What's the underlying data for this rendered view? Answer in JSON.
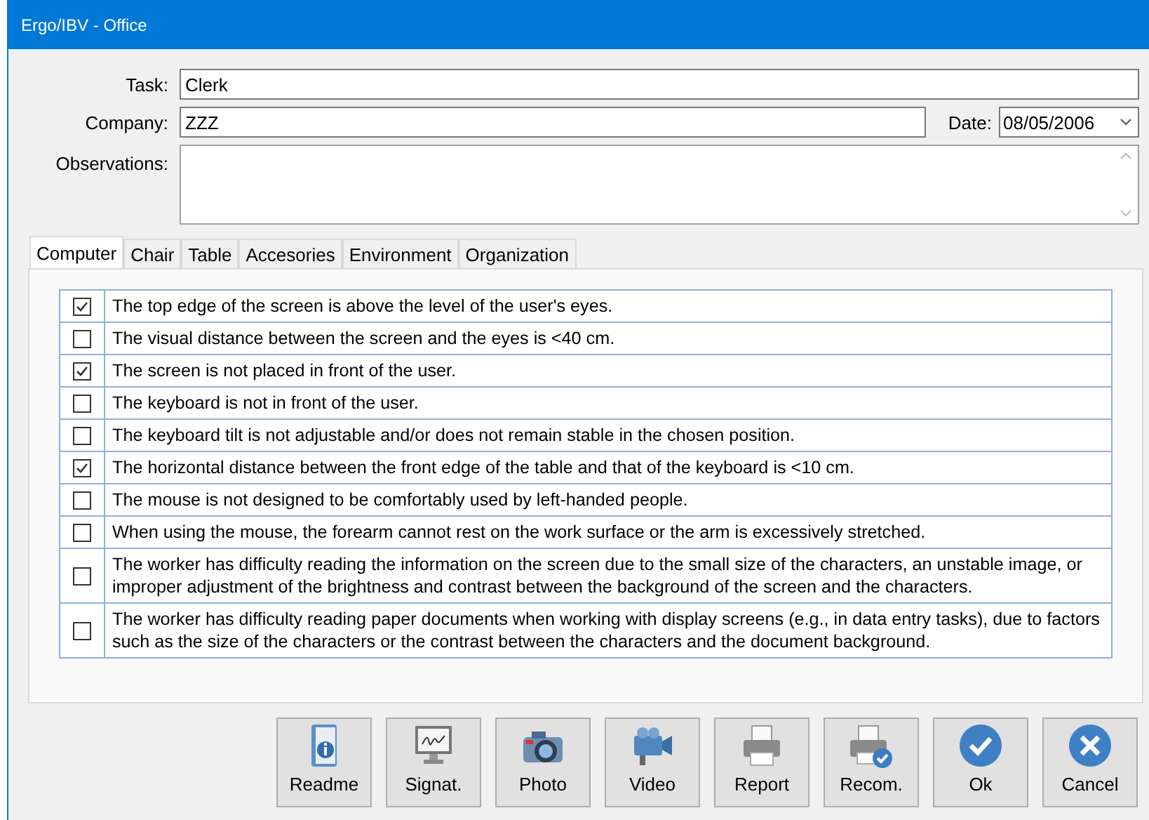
{
  "window": {
    "title": "Ergo/IBV - Office"
  },
  "form": {
    "task": {
      "label": "Task:",
      "value": "Clerk"
    },
    "company": {
      "label": "Company:",
      "value": "ZZZ"
    },
    "date": {
      "label": "Date:",
      "value": "08/05/2006"
    },
    "observations": {
      "label": "Observations:"
    }
  },
  "tabs": [
    {
      "label": "Computer",
      "selected": true
    },
    {
      "label": "Chair",
      "selected": false
    },
    {
      "label": "Table",
      "selected": false
    },
    {
      "label": "Accesories",
      "selected": false
    },
    {
      "label": "Environment",
      "selected": false
    },
    {
      "label": "Organization",
      "selected": false
    }
  ],
  "checklist": [
    {
      "text": "The top edge of the screen is above the level of the user's eyes.",
      "checked": true
    },
    {
      "text": "The visual distance between the screen and the eyes is <40 cm.",
      "checked": false
    },
    {
      "text": "The screen is not placed in front of the user.",
      "checked": true
    },
    {
      "text": "The keyboard is not in front of the user.",
      "checked": false
    },
    {
      "text": "The keyboard tilt is not adjustable and/or does not remain stable in the chosen position.",
      "checked": false
    },
    {
      "text": "The horizontal distance between the front edge of the table and that of the keyboard is <10 cm.",
      "checked": true
    },
    {
      "text": "The mouse is not designed to be comfortably used by left-handed people.",
      "checked": false
    },
    {
      "text": "When using the mouse, the forearm cannot rest on the work surface or the arm is excessively stretched.",
      "checked": false
    },
    {
      "text": "The worker has difficulty reading the information on the screen due to the small size of the characters, an unstable image, or improper adjustment of the brightness and contrast between the background of the screen and the characters.",
      "checked": false
    },
    {
      "text": "The worker has difficulty reading paper documents when working with display screens (e.g., in data entry tasks), due to factors such as the size of the characters or the contrast between the characters and the document background.",
      "checked": false
    }
  ],
  "buttons": [
    {
      "label": "Readme",
      "kind": "readme"
    },
    {
      "label": "Signat.",
      "kind": "signature"
    },
    {
      "label": "Photo",
      "kind": "photo"
    },
    {
      "label": "Video",
      "kind": "video"
    },
    {
      "label": "Report",
      "kind": "report"
    },
    {
      "label": "Recom.",
      "kind": "recommend"
    },
    {
      "label": "Ok",
      "kind": "ok"
    },
    {
      "label": "Cancel",
      "kind": "cancel"
    }
  ]
}
